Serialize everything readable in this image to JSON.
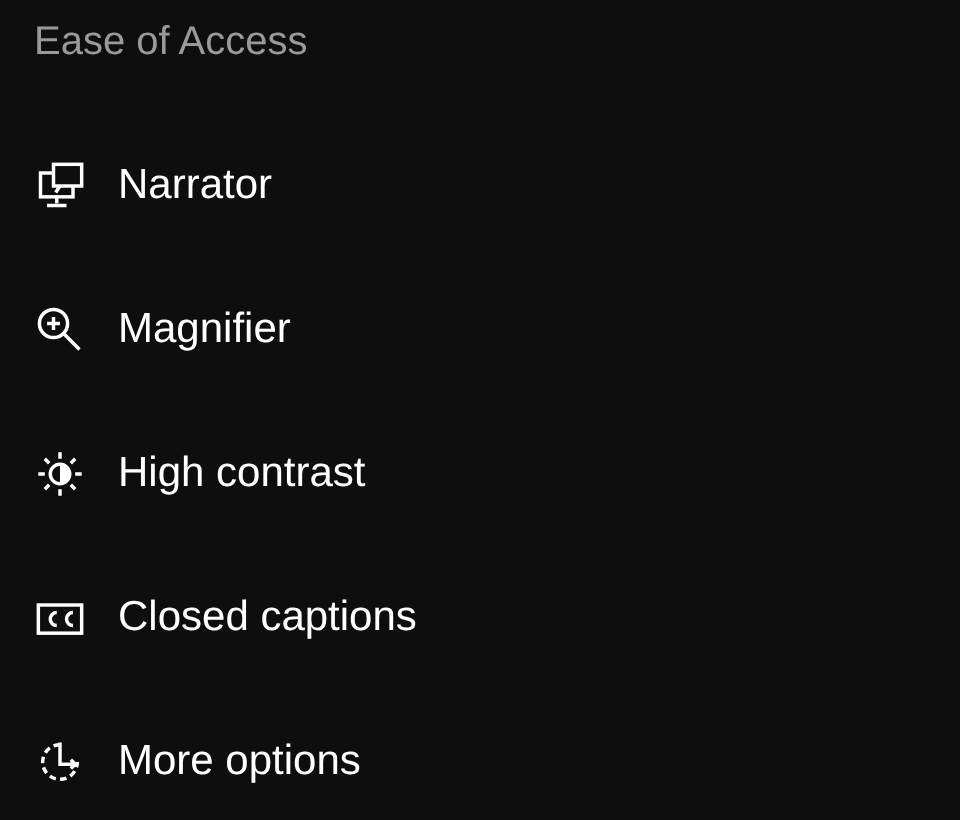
{
  "title": "Ease of Access",
  "items": [
    {
      "label": "Narrator",
      "kind": "narrator"
    },
    {
      "label": "Magnifier",
      "kind": "magnifier"
    },
    {
      "label": "High contrast",
      "kind": "contrast"
    },
    {
      "label": "Closed captions",
      "kind": "captions"
    },
    {
      "label": "More options",
      "kind": "more"
    }
  ]
}
